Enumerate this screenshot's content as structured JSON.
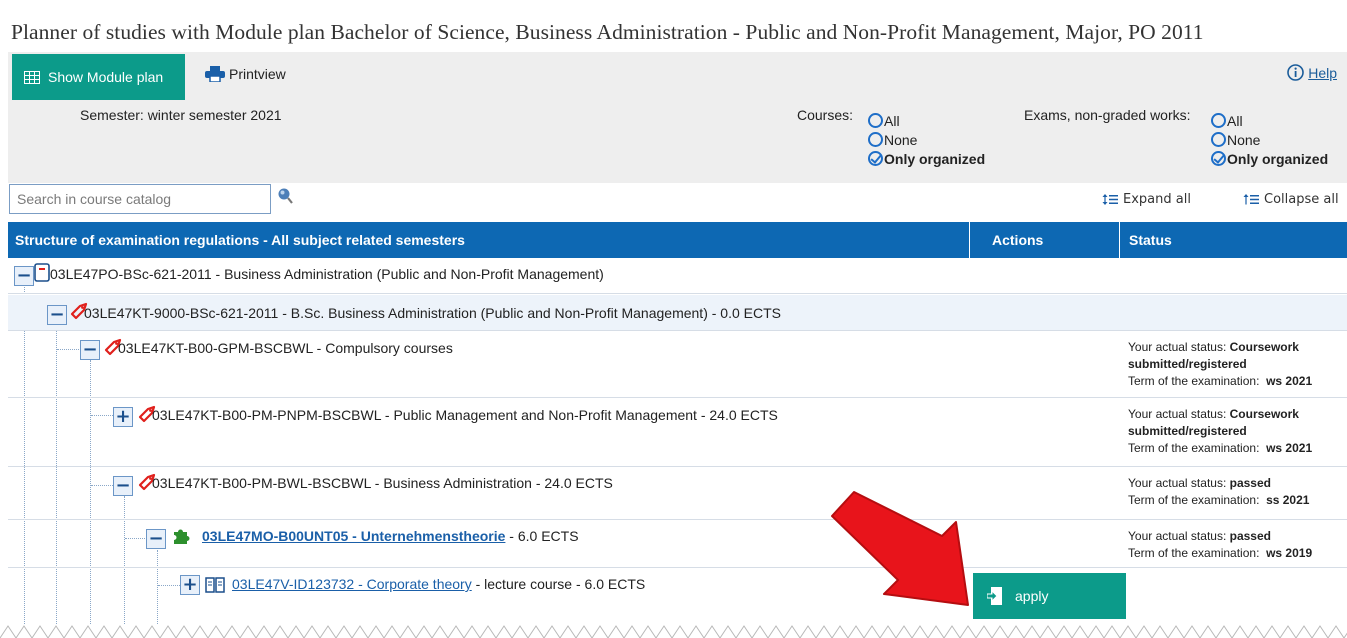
{
  "title": "Planner of studies with Module plan Bachelor of Science, Business Administration - Public and Non-Profit Management, Major, PO 2011",
  "toolbar": {
    "show_module_plan": "Show Module plan",
    "printview": "Printview",
    "help": "Help"
  },
  "semester": "Semester: winter semester 2021",
  "filters": {
    "courses_label": "Courses:",
    "exams_label": "Exams, non-graded works:",
    "options": [
      "All",
      "None",
      "Only organized"
    ],
    "selected": "Only organized"
  },
  "search": {
    "placeholder": "Search in course catalog"
  },
  "tree_controls": {
    "expand_all": "Expand all",
    "collapse_all": "Collapse all"
  },
  "table": {
    "headers": {
      "structure": "Structure of examination regulations - All subject related semesters",
      "actions": "Actions",
      "status": "Status"
    },
    "rows": [
      {
        "code": "03LE47PO-BSc-621-2011",
        "title": " - Business Administration (Public and Non-Profit Management)",
        "toggle": "−",
        "icon": "document-icon"
      },
      {
        "code": "03LE47KT-9000-BSc-621-2011",
        "title": " - B.Sc. Business Administration (Public and Non-Profit Management) - 0.0 ECTS",
        "toggle": "−",
        "icon": "tag-icon"
      },
      {
        "code": "03LE47KT-B00-GPM-BSCBWL",
        "title": " - Compulsory courses",
        "toggle": "−",
        "icon": "tag-icon",
        "status": {
          "prefix": "Your actual status: ",
          "value": "Coursework",
          "value2": "submitted/registered",
          "term_label": "Term of the examination:",
          "term": "ws 2021"
        }
      },
      {
        "code": "03LE47KT-B00-PM-PNPM-BSCBWL",
        "title": " - Public Management and Non-Profit Management - 24.0 ECTS",
        "toggle": "+",
        "icon": "tag-icon",
        "status": {
          "prefix": "Your actual status: ",
          "value": "Coursework",
          "value2": "submitted/registered",
          "term_label": "Term of the examination:",
          "term": "ws 2021"
        }
      },
      {
        "code": "03LE47KT-B00-PM-BWL-BSCBWL",
        "title": " - Business Administration - 24.0 ECTS",
        "toggle": "−",
        "icon": "tag-icon",
        "status": {
          "prefix": "Your actual status: ",
          "value": "passed",
          "term_label": "Term of the examination:",
          "term": "ss 2021"
        }
      },
      {
        "code": "03LE47MO-B00UNT05 - Unternehmenstheorie",
        "title": " - 6.0 ECTS",
        "toggle": "−",
        "icon": "puzzle-icon",
        "status": {
          "prefix": "Your actual status: ",
          "value": "passed",
          "term_label": "Term of the examination:",
          "term": "ws 2019"
        }
      },
      {
        "code": "03LE47V-ID123732 - Corporate theory",
        "title": " - lecture course - 6.0 ECTS",
        "toggle": "+",
        "icon": "book-icon",
        "action": "apply"
      }
    ]
  },
  "colors": {
    "teal": "#0c9b8a",
    "header_blue": "#0d68b3",
    "link_blue": "#1a5fa8",
    "arrow_red": "#e8141b"
  }
}
